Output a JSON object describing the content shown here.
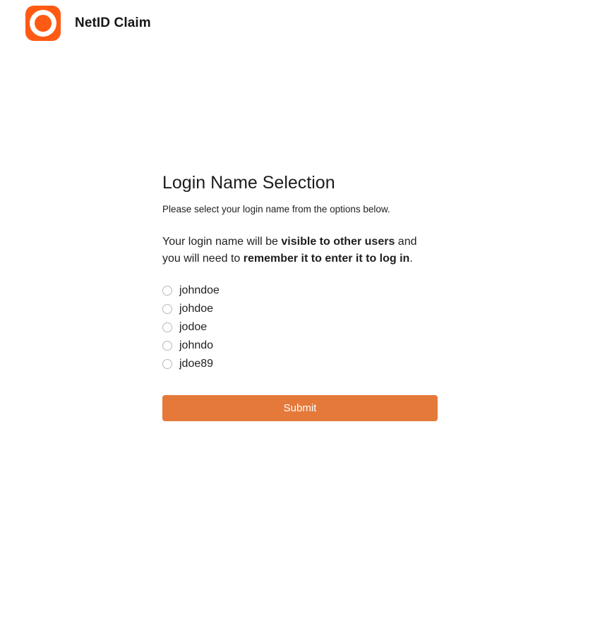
{
  "header": {
    "logo_icon": "netid-ring-logo-icon",
    "title": "NetID Claim"
  },
  "form": {
    "title": "Login Name Selection",
    "subtitle": "Please select your login name from the options below.",
    "notice": {
      "part1": "Your login name will be ",
      "bold1": "visible to other users",
      "part2": " and you will need to ",
      "bold2": "remember it to enter it to log in",
      "part3": "."
    },
    "options": [
      {
        "label": "johndoe",
        "selected": false
      },
      {
        "label": "johdoe",
        "selected": false
      },
      {
        "label": "jodoe",
        "selected": false
      },
      {
        "label": "johndo",
        "selected": false
      },
      {
        "label": "jdoe89",
        "selected": false
      }
    ],
    "submit_label": "Submit"
  },
  "colors": {
    "brand": "#ff5a14",
    "button": "#e4793a",
    "radio_border": "#b8b8b8"
  }
}
